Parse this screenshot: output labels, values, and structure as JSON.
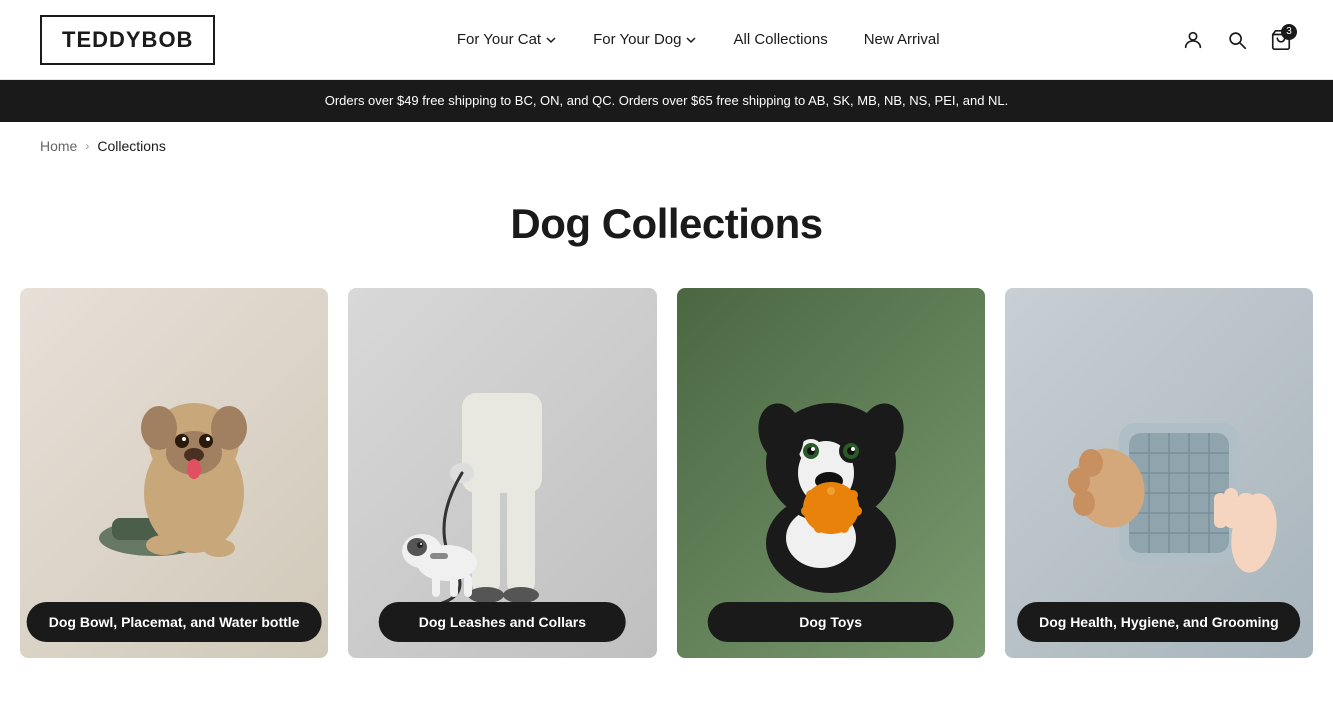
{
  "header": {
    "logo": "TEDDYBOB",
    "nav": [
      {
        "id": "for-your-cat",
        "label": "For Your Cat",
        "hasDropdown": true
      },
      {
        "id": "for-your-dog",
        "label": "For Your Dog",
        "hasDropdown": true
      },
      {
        "id": "all-collections",
        "label": "All Collections",
        "hasDropdown": false
      },
      {
        "id": "new-arrival",
        "label": "New Arrival",
        "hasDropdown": false
      }
    ],
    "cartCount": "3"
  },
  "banner": {
    "text": "Orders over $49 free shipping to BC, ON, and QC. Orders over $65 free shipping to AB, SK, MB, NB, NS, PEI, and NL."
  },
  "breadcrumb": {
    "home": "Home",
    "separator": "›",
    "current": "Collections"
  },
  "pageTitle": "Dog Collections",
  "collections": [
    {
      "id": "dog-bowl",
      "label": "Dog Bowl, Placemat, and Water bottle",
      "emoji": "🍽️",
      "bgClass": "card-1"
    },
    {
      "id": "dog-leashes",
      "label": "Dog Leashes and Collars",
      "emoji": "🦮",
      "bgClass": "card-2"
    },
    {
      "id": "dog-toys",
      "label": "Dog Toys",
      "emoji": "🎾",
      "bgClass": "card-3"
    },
    {
      "id": "dog-health",
      "label": "Dog Health, Hygiene, and Grooming",
      "emoji": "🧴",
      "bgClass": "card-4"
    }
  ]
}
